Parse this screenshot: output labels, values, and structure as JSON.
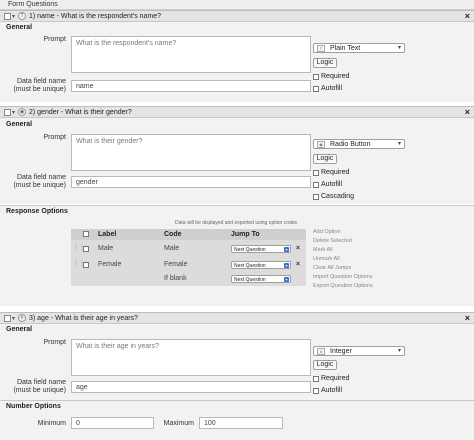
{
  "page_title": "Form Questions",
  "questions": [
    {
      "header": "1) name - What is the respondent's name?",
      "type_icon": "T",
      "section_general": "General",
      "prompt_label": "Prompt",
      "prompt_value": "What is the respondent's name?",
      "type_value": "Plain Text",
      "logic_label": "Logic",
      "datafield_label_1": "Data field name",
      "datafield_label_2": "(must be unique)",
      "datafield_value": "name",
      "required_label": "Required",
      "autofill_label": "Autofill"
    },
    {
      "header": "2) gender - What is their gender?",
      "type_icon": "◉",
      "section_general": "General",
      "prompt_label": "Prompt",
      "prompt_value": "What is their gender?",
      "type_value": "Radio Button",
      "logic_label": "Logic",
      "datafield_label_1": "Data field name",
      "datafield_label_2": "(must be unique)",
      "datafield_value": "gender",
      "required_label": "Required",
      "autofill_label": "Autofill",
      "cascading_label": "Cascading",
      "response_section": "Response Options",
      "response_note": "Data will be displayed and exported using option codes",
      "columns": [
        "Label",
        "Code",
        "Jump To"
      ],
      "options": [
        {
          "label": "Male",
          "code": "Male",
          "jump": "Next Question"
        },
        {
          "label": "Female",
          "code": "Female",
          "jump": "Next Question"
        },
        {
          "label": "",
          "code": "If blank",
          "jump": "Next Question"
        }
      ],
      "side_links": [
        "Add Option",
        "Delete Selected",
        "Mark All",
        "Unmark All",
        "Clear All Jumps",
        "Import Question Options",
        "Export Question Options"
      ]
    },
    {
      "header": "3) age - What is their age in years?",
      "type_icon": "#",
      "section_general": "General",
      "prompt_label": "Prompt",
      "prompt_value": "What is their age in years?",
      "type_value": "Integer",
      "logic_label": "Logic",
      "datafield_label_1": "Data field name",
      "datafield_label_2": "(must be unique)",
      "datafield_value": "age",
      "required_label": "Required",
      "autofill_label": "Autofill",
      "number_section": "Number Options",
      "minimum_label": "Minimum",
      "minimum_value": "0",
      "maximum_label": "Maximum",
      "maximum_value": "100"
    }
  ]
}
